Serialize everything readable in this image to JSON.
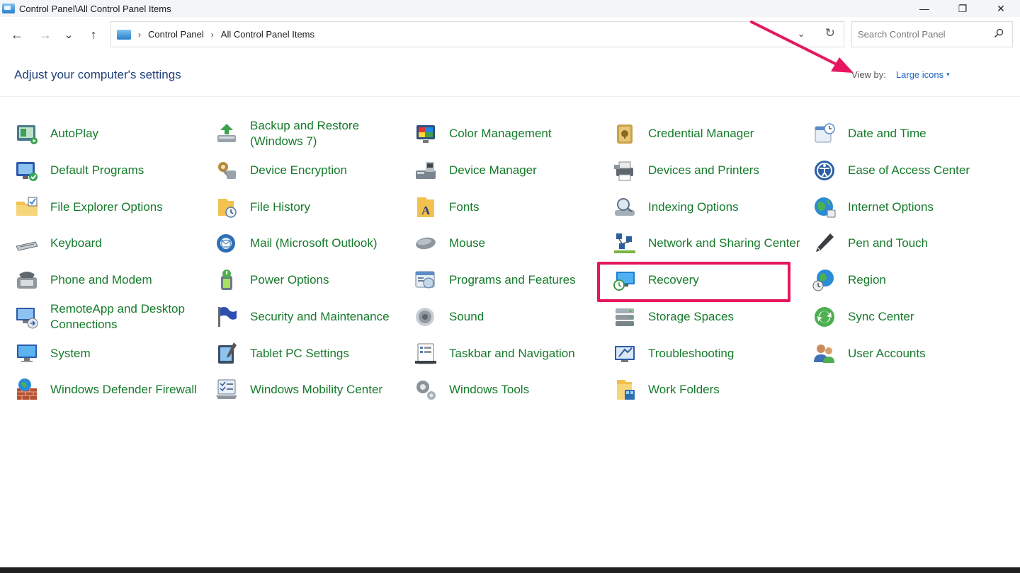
{
  "window": {
    "title": "Control Panel\\All Control Panel Items",
    "minimize": "—",
    "maximize": "❐",
    "close": "✕"
  },
  "nav": {
    "back": "←",
    "forward": "→",
    "recent": "⌄",
    "up": "↑"
  },
  "address": {
    "crumbs": [
      "Control Panel",
      "All Control Panel Items"
    ],
    "separator": "›",
    "dropdown": "⌄",
    "refresh": "↻"
  },
  "search": {
    "placeholder": "Search Control Panel",
    "value": ""
  },
  "header": {
    "title": "Adjust your computer's settings",
    "view_by_label": "View by:",
    "view_by_value": "Large icons",
    "caret": "▾"
  },
  "items": [
    {
      "label": "AutoPlay",
      "icon": "autoplay-icon"
    },
    {
      "label": "Backup and Restore (Windows 7)",
      "icon": "backup-icon"
    },
    {
      "label": "Color Management",
      "icon": "color-management-icon"
    },
    {
      "label": "Credential Manager",
      "icon": "credential-manager-icon"
    },
    {
      "label": "Date and Time",
      "icon": "date-time-icon"
    },
    {
      "label": "Default Programs",
      "icon": "default-programs-icon"
    },
    {
      "label": "Device Encryption",
      "icon": "device-encryption-icon"
    },
    {
      "label": "Device Manager",
      "icon": "device-manager-icon"
    },
    {
      "label": "Devices and Printers",
      "icon": "devices-printers-icon"
    },
    {
      "label": "Ease of Access Center",
      "icon": "ease-of-access-icon"
    },
    {
      "label": "File Explorer Options",
      "icon": "file-explorer-options-icon"
    },
    {
      "label": "File History",
      "icon": "file-history-icon"
    },
    {
      "label": "Fonts",
      "icon": "fonts-icon"
    },
    {
      "label": "Indexing Options",
      "icon": "indexing-options-icon"
    },
    {
      "label": "Internet Options",
      "icon": "internet-options-icon"
    },
    {
      "label": "Keyboard",
      "icon": "keyboard-icon"
    },
    {
      "label": "Mail (Microsoft Outlook)",
      "icon": "mail-icon"
    },
    {
      "label": "Mouse",
      "icon": "mouse-icon"
    },
    {
      "label": "Network and Sharing Center",
      "icon": "network-sharing-icon"
    },
    {
      "label": "Pen and Touch",
      "icon": "pen-touch-icon"
    },
    {
      "label": "Phone and Modem",
      "icon": "phone-modem-icon"
    },
    {
      "label": "Power Options",
      "icon": "power-options-icon"
    },
    {
      "label": "Programs and Features",
      "icon": "programs-features-icon"
    },
    {
      "label": "Recovery",
      "icon": "recovery-icon"
    },
    {
      "label": "Region",
      "icon": "region-icon"
    },
    {
      "label": "RemoteApp and Desktop Connections",
      "icon": "remoteapp-icon"
    },
    {
      "label": "Security and Maintenance",
      "icon": "security-maintenance-icon"
    },
    {
      "label": "Sound",
      "icon": "sound-icon"
    },
    {
      "label": "Storage Spaces",
      "icon": "storage-spaces-icon"
    },
    {
      "label": "Sync Center",
      "icon": "sync-center-icon"
    },
    {
      "label": "System",
      "icon": "system-icon"
    },
    {
      "label": "Tablet PC Settings",
      "icon": "tablet-pc-icon"
    },
    {
      "label": "Taskbar and Navigation",
      "icon": "taskbar-navigation-icon"
    },
    {
      "label": "Troubleshooting",
      "icon": "troubleshooting-icon"
    },
    {
      "label": "User Accounts",
      "icon": "user-accounts-icon"
    },
    {
      "label": "Windows Defender Firewall",
      "icon": "firewall-icon"
    },
    {
      "label": "Windows Mobility Center",
      "icon": "mobility-center-icon"
    },
    {
      "label": "Windows Tools",
      "icon": "windows-tools-icon"
    },
    {
      "label": "Work Folders",
      "icon": "work-folders-icon"
    }
  ],
  "annotations": {
    "highlight_color": "#e6175e",
    "highlighted_item": "Recovery"
  },
  "colors": {
    "link_green": "#157a2a",
    "header_blue": "#1f3e79",
    "accent_blue": "#1f66c7"
  }
}
